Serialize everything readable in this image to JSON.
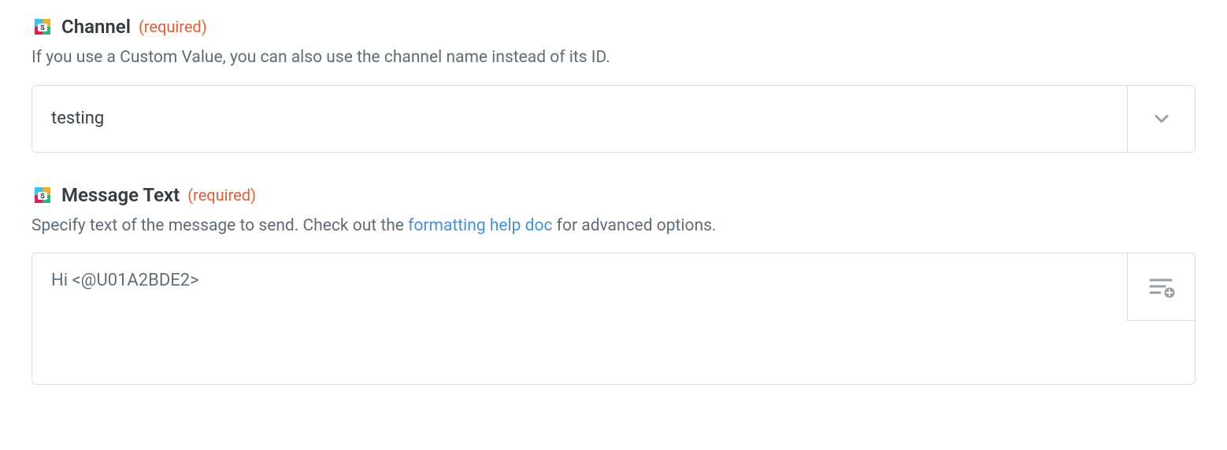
{
  "channel": {
    "label": "Channel",
    "required_tag": "(required)",
    "description": "If you use a Custom Value, you can also use the channel name instead of its ID.",
    "value": "testing"
  },
  "message_text": {
    "label": "Message Text",
    "required_tag": "(required)",
    "description_prefix": "Specify text of the message to send. Check out the ",
    "description_link": "formatting help doc",
    "description_suffix": " for advanced options.",
    "value": "Hi <@U01A2BDE2>"
  }
}
